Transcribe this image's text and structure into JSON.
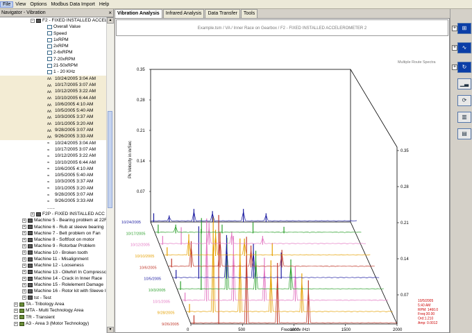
{
  "menubar": {
    "items": [
      "File",
      "View",
      "Options",
      "Modbus Data Import",
      "Help"
    ]
  },
  "navigator": {
    "title": "Navigator - Vibration",
    "close_label": "×",
    "rows": [
      {
        "indent": 44,
        "icon": "exp-minus-mach",
        "label": "F2 - FIXED INSTALLED ACCELE",
        "hl": false
      },
      {
        "indent": 68,
        "icon": "plot",
        "label": "Overall Value",
        "hl": false
      },
      {
        "indent": 68,
        "icon": "plot",
        "label": "Speed",
        "hl": false
      },
      {
        "indent": 68,
        "icon": "plot",
        "label": "1xRPM",
        "hl": false
      },
      {
        "indent": 68,
        "icon": "plot",
        "label": "2xRPM",
        "hl": false
      },
      {
        "indent": 68,
        "icon": "plot",
        "label": "2-6xRPM",
        "hl": false
      },
      {
        "indent": 68,
        "icon": "plot",
        "label": "7-20xRPM",
        "hl": false
      },
      {
        "indent": 68,
        "icon": "plot",
        "label": "21-50xRPM",
        "hl": false
      },
      {
        "indent": 68,
        "icon": "plot",
        "label": "1 - 20 KHz",
        "hl": false
      },
      {
        "indent": 68,
        "icon": "spec",
        "label": "10/24/2005 3:04 AM",
        "hl": true
      },
      {
        "indent": 68,
        "icon": "spec",
        "label": "10/17/2005 3:07 AM",
        "hl": true
      },
      {
        "indent": 68,
        "icon": "spec",
        "label": "10/12/2005 3:22 AM",
        "hl": true
      },
      {
        "indent": 68,
        "icon": "spec",
        "label": "10/10/2005 6:44 AM",
        "hl": true
      },
      {
        "indent": 68,
        "icon": "spec",
        "label": "10/6/2005 4:10 AM",
        "hl": true
      },
      {
        "indent": 68,
        "icon": "spec",
        "label": "10/5/2005 5:40 AM",
        "hl": true
      },
      {
        "indent": 68,
        "icon": "spec",
        "label": "10/3/2005 3:37 AM",
        "hl": true
      },
      {
        "indent": 68,
        "icon": "spec",
        "label": "10/1/2005 3:20 AM",
        "hl": true
      },
      {
        "indent": 68,
        "icon": "spec",
        "label": "9/28/2005 3:07 AM",
        "hl": true
      },
      {
        "indent": 68,
        "icon": "spec",
        "label": "9/26/2005 3:33 AM",
        "hl": true
      },
      {
        "indent": 68,
        "icon": "wave",
        "label": "10/24/2005 3:04 AM",
        "hl": false
      },
      {
        "indent": 68,
        "icon": "wave",
        "label": "10/17/2005 3:07 AM",
        "hl": false
      },
      {
        "indent": 68,
        "icon": "wave",
        "label": "10/12/2005 3:22 AM",
        "hl": false
      },
      {
        "indent": 68,
        "icon": "wave",
        "label": "10/10/2005 6:44 AM",
        "hl": false
      },
      {
        "indent": 68,
        "icon": "wave",
        "label": "10/6/2005 4:10 AM",
        "hl": false
      },
      {
        "indent": 68,
        "icon": "wave",
        "label": "10/5/2005 5:40 AM",
        "hl": false
      },
      {
        "indent": 68,
        "icon": "wave",
        "label": "10/3/2005 3:37 AM",
        "hl": false
      },
      {
        "indent": 68,
        "icon": "wave",
        "label": "10/1/2005 3:20 AM",
        "hl": false
      },
      {
        "indent": 68,
        "icon": "wave",
        "label": "9/28/2005 3:07 AM",
        "hl": false
      },
      {
        "indent": 68,
        "icon": "wave",
        "label": "9/26/2005 3:33 AM",
        "hl": false
      },
      {
        "indent": 68,
        "icon": "none",
        "label": "......",
        "hl": false
      },
      {
        "indent": 44,
        "icon": "exp-plus-mach",
        "label": "F2P - FIXED INSTALLED ACC P",
        "hl": false
      },
      {
        "indent": 32,
        "icon": "exp-plus-mach",
        "label": "Machine 5 - Bearing problem at 22F",
        "hl": false
      },
      {
        "indent": 32,
        "icon": "exp-plus-mach",
        "label": "Machine 6 - Rub at sleeve bearing",
        "hl": false
      },
      {
        "indent": 32,
        "icon": "exp-plus-mach",
        "label": "Machine 7 - Belt problem on Fan",
        "hl": false
      },
      {
        "indent": 32,
        "icon": "exp-plus-mach",
        "label": "Machine 8 - Softfoot on motor",
        "hl": false
      },
      {
        "indent": 32,
        "icon": "exp-plus-mach",
        "label": "Machine 9 - Rotorbar Problem",
        "hl": false
      },
      {
        "indent": 32,
        "icon": "exp-plus-mach",
        "label": "Machine 10 - Broken tooth",
        "hl": false
      },
      {
        "indent": 32,
        "icon": "exp-plus-mach",
        "label": "Machine 11 - Misalignment",
        "hl": false
      },
      {
        "indent": 32,
        "icon": "exp-plus-mach",
        "label": "Machine 12 - Looseness",
        "hl": false
      },
      {
        "indent": 32,
        "icon": "exp-plus-mach",
        "label": "Machine 13 - Oilwhirl In Compressc",
        "hl": false
      },
      {
        "indent": 32,
        "icon": "exp-plus-mach",
        "label": "Machine 14 - Crack in Inner Race",
        "hl": false
      },
      {
        "indent": 32,
        "icon": "exp-plus-mach",
        "label": "Machine 15 - Rolelement Damage",
        "hl": false
      },
      {
        "indent": 32,
        "icon": "exp-plus-mach",
        "label": "Machine 16 - Rotor kit with Sleeve I",
        "hl": false
      },
      {
        "indent": 32,
        "icon": "exp-plus-mach",
        "label": "tst - Test",
        "hl": false
      },
      {
        "indent": 20,
        "icon": "exp-plus-area",
        "label": "TA - Tribology Area",
        "hl": false
      },
      {
        "indent": 20,
        "icon": "exp-plus-area",
        "label": "MTA - Multi Technology Area",
        "hl": false
      },
      {
        "indent": 20,
        "icon": "exp-plus-area",
        "label": "TR - Transient",
        "hl": false
      },
      {
        "indent": 20,
        "icon": "exp-plus-area",
        "label": "A3 - Area 3 (Motor Technology)",
        "hl": false
      }
    ]
  },
  "tabs": [
    {
      "label": "Vibration Analysis",
      "active": true
    },
    {
      "label": "Infrared Analysis",
      "active": false
    },
    {
      "label": "Data Transfer",
      "active": false
    },
    {
      "label": "Tools",
      "active": false
    }
  ],
  "plot": {
    "header": "Example.tsm / VA / Inner Race on Gearbox / F2 - FIXED INSTALLED ACCELEROMETER 2",
    "mode_label": "Multiple Route Spectra",
    "ylabel": "Pk Velocity in in/Sec",
    "xlabel": "Frequency (Hz)",
    "readout": [
      "10/5/2005",
      "5:40 AM",
      "RPM: 1460.0",
      "Freq:30.00",
      "Ord:1.210",
      "Amp: 0.0012"
    ]
  },
  "chart_data": {
    "type": "line",
    "title": "",
    "xlabel": "Frequency (Hz)",
    "ylabel": "Pk Velocity in in/Sec",
    "xlim": [
      0,
      2000
    ],
    "ylim": [
      0,
      0.35
    ],
    "x_ticks": [
      0,
      500,
      1000,
      1500,
      2000
    ],
    "y_ticks": [
      0.07,
      0.14,
      0.21,
      0.28,
      0.35
    ],
    "back_y_ticks": [
      "0.35",
      "0.28",
      "0.21",
      "0.14",
      "0.07"
    ],
    "series": [
      {
        "name": "10/24/2005",
        "color": "#1a1aa0",
        "peaks": [
          [
            30,
            0.02
          ],
          [
            180,
            0.015
          ],
          [
            420,
            0.03
          ],
          [
            600,
            0.025
          ],
          [
            900,
            0.03
          ],
          [
            1120,
            0.02
          ]
        ]
      },
      {
        "name": "10/17/2005",
        "color": "#2ca02c",
        "peaks": [
          [
            30,
            0.02
          ],
          [
            200,
            0.02
          ],
          [
            450,
            0.035
          ],
          [
            650,
            0.02
          ],
          [
            950,
            0.025
          ],
          [
            1250,
            0.015
          ]
        ]
      },
      {
        "name": "10/12/2005",
        "color": "#e377c2",
        "peaks": [
          [
            30,
            0.02
          ],
          [
            210,
            0.04
          ],
          [
            480,
            0.05
          ],
          [
            700,
            0.03
          ],
          [
            1000,
            0.02
          ]
        ]
      },
      {
        "name": "10/10/2005",
        "color": "#e5a000",
        "peaks": [
          [
            30,
            0.02
          ],
          [
            240,
            0.05
          ],
          [
            500,
            0.06
          ],
          [
            780,
            0.04
          ],
          [
            1050,
            0.03
          ]
        ]
      },
      {
        "name": "10/6/2005",
        "color": "#c0392b",
        "peaks": [
          [
            30,
            0.02
          ],
          [
            220,
            0.06
          ],
          [
            500,
            0.08
          ],
          [
            800,
            0.05
          ],
          [
            1100,
            0.04
          ]
        ]
      },
      {
        "name": "10/5/2005",
        "color": "#1a1aa0",
        "peaks": [
          [
            30,
            0.02
          ],
          [
            250,
            0.12
          ],
          [
            520,
            0.1
          ],
          [
            780,
            0.08
          ],
          [
            1050,
            0.06
          ]
        ]
      },
      {
        "name": "10/3/2005",
        "color": "#2ca02c",
        "peaks": [
          [
            30,
            0.02
          ],
          [
            230,
            0.14
          ],
          [
            480,
            0.12
          ],
          [
            760,
            0.09
          ],
          [
            1100,
            0.07
          ]
        ]
      },
      {
        "name": "10/1/2005",
        "color": "#e377c2",
        "peaks": [
          [
            30,
            0.02
          ],
          [
            240,
            0.19
          ],
          [
            500,
            0.15
          ],
          [
            800,
            0.1
          ],
          [
            1100,
            0.08
          ]
        ]
      },
      {
        "name": "9/28/2005",
        "color": "#e5a000",
        "peaks": [
          [
            30,
            0.02
          ],
          [
            260,
            0.22
          ],
          [
            520,
            0.17
          ],
          [
            820,
            0.12
          ],
          [
            1120,
            0.09
          ]
        ]
      },
      {
        "name": "9/26/2005",
        "color": "#c0392b",
        "peaks": [
          [
            30,
            0.02
          ],
          [
            270,
            0.25
          ],
          [
            540,
            0.2
          ],
          [
            840,
            0.14
          ],
          [
            1140,
            0.1
          ]
        ]
      }
    ]
  },
  "sidebar": {
    "buttons": [
      "grid-plot-icon",
      "sine-wave-icon",
      "cycle-icon",
      "spectrum-icon",
      "refresh-icon",
      "chart-bars-icon",
      "chart-area-icon"
    ]
  }
}
